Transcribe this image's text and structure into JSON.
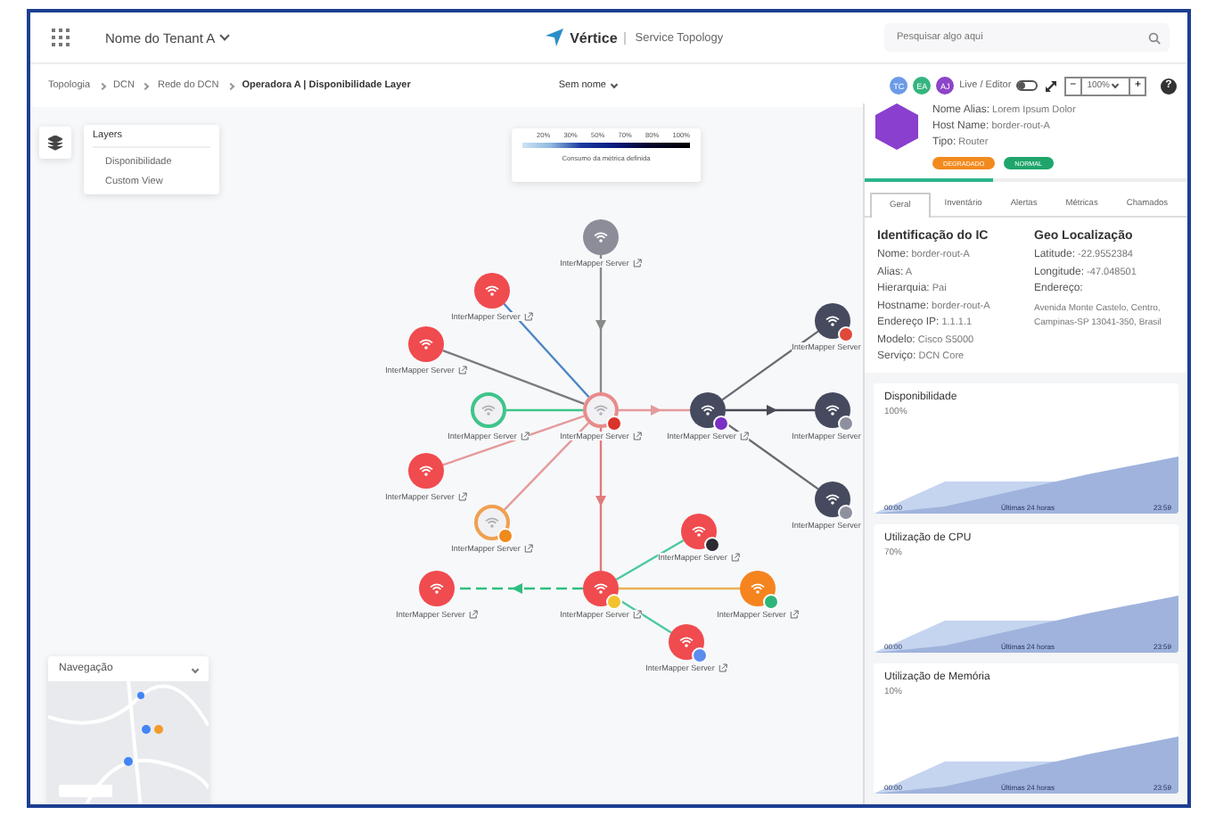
{
  "header": {
    "tenant": "Nome do Tenant A",
    "app_name": "Vértice",
    "subtitle": "Service Topology",
    "search": {
      "placeholder": "Pesquisar algo aqui"
    }
  },
  "breadcrumb": [
    "Topologia",
    "DCN",
    "Rede do DCN",
    "Operadora A | Disponibilidade Layer"
  ],
  "view_select": "Sem nome",
  "users": [
    {
      "initials": "TC",
      "color": "#6b9be8"
    },
    {
      "initials": "EA",
      "color": "#35b57e"
    },
    {
      "initials": "AJ",
      "color": "#8d45c8"
    }
  ],
  "mode_toggle": {
    "label": "Live / Editor",
    "on": false
  },
  "zoom": {
    "minus": "−",
    "value": "100%",
    "plus": "+"
  },
  "help": "?",
  "layers": {
    "title": "Layers",
    "items": [
      {
        "label": "Disponibilidade"
      },
      {
        "label": "Custom View"
      }
    ]
  },
  "legend": {
    "ticks": [
      "20%",
      "30%",
      "50%",
      "70%",
      "80%",
      "100%"
    ],
    "caption": "Consumo da métrica definida"
  },
  "nodes": [
    {
      "label": "InterMapper Server",
      "color": "#8d8d99",
      "kind": "filled"
    },
    {
      "label": "InterMapper Server",
      "color": "#f04b4f",
      "kind": "filled"
    },
    {
      "label": "InterMapper Server",
      "color": "#454a5e",
      "kind": "filled",
      "badge": {
        "color": "#e0483a"
      }
    },
    {
      "label": "InterMapper Server",
      "color": "#f04b4f",
      "kind": "filled"
    },
    {
      "label": "InterMapper Server",
      "color": "#3ec58a",
      "kind": "ring"
    },
    {
      "label": "InterMapper Server",
      "color": "#e88b8b",
      "kind": "ring",
      "badge": {
        "color": "#d9342b"
      }
    },
    {
      "label": "InterMapper Server",
      "color": "#454a5e",
      "kind": "filled",
      "badge": {
        "color": "#7b2fc4"
      }
    },
    {
      "label": "InterMapper Server",
      "color": "#454a5e",
      "kind": "filled",
      "badge": {
        "color": "#8e90a0"
      }
    },
    {
      "label": "InterMapper Server",
      "color": "#f04b4f",
      "kind": "filled"
    },
    {
      "label": "InterMapper Server",
      "color": "#454a5e",
      "kind": "filled",
      "badge": {
        "color": "#8e90a0"
      }
    },
    {
      "label": "InterMapper Server",
      "color": "#f0a050",
      "kind": "ring",
      "badge": {
        "color": "#f08a1c"
      }
    },
    {
      "label": "InterMapper Server",
      "color": "#f04b4f",
      "kind": "filled",
      "badge": {
        "color": "#2b2b33"
      }
    },
    {
      "label": "InterMapper Server",
      "color": "#f04b4f",
      "kind": "filled"
    },
    {
      "label": "InterMapper Server",
      "color": "#f04b4f",
      "kind": "filled",
      "badge": {
        "color": "#f2c230"
      }
    },
    {
      "label": "InterMapper Server",
      "color": "#f5841f",
      "kind": "filled",
      "badge": {
        "color": "#2fb57a"
      }
    },
    {
      "label": "InterMapper Server",
      "color": "#f04b4f",
      "kind": "filled",
      "badge": {
        "color": "#5b8def"
      }
    }
  ],
  "navigation": {
    "title": "Navegação"
  },
  "details": {
    "fields": [
      {
        "label": "Nome Alias:",
        "value": "Lorem Ipsum Dolor"
      },
      {
        "label": "Host Name:",
        "value": "border-rout-A"
      },
      {
        "label": "Tipo:",
        "value": "Router"
      }
    ],
    "tags": [
      {
        "text": "DEGRADADO",
        "color": "#f28a1e"
      },
      {
        "text": "NORMAL",
        "color": "#1fa56b"
      }
    ],
    "loading": {
      "level": 0.4
    },
    "tabs": [
      {
        "label": "Geral",
        "selected": true
      },
      {
        "label": "Inventário",
        "selected": false
      },
      {
        "label": "Alertas",
        "selected": false
      },
      {
        "label": "Métricas",
        "selected": false
      },
      {
        "label": "Chamados",
        "selected": false
      }
    ],
    "identification": {
      "title": "Identificação do IC",
      "fields": [
        {
          "label": "Nome:",
          "value": "border-rout-A"
        },
        {
          "label": "Alias:",
          "value": "A"
        },
        {
          "label": "Hierarquia:",
          "value": "Pai"
        },
        {
          "label": "Hostname:",
          "value": "border-rout-A"
        },
        {
          "label": "Endereço IP:",
          "value": "1.1.1.1"
        },
        {
          "label": "Modelo:",
          "value": "Cisco S5000"
        },
        {
          "label": "Serviço:",
          "value": "DCN Core"
        }
      ]
    },
    "geo": {
      "title": "Geo Localização",
      "fields": [
        {
          "label": "Latitude:",
          "value": "-22.9552384"
        },
        {
          "label": "Longitude:",
          "value": "-47.048501"
        }
      ],
      "address_label": "Endereço:",
      "address": "Avenida Monte Castelo, Centro, Campinas-SP 13041-350, Brasil"
    },
    "metrics": [
      {
        "title": "Disponibilidade",
        "value": "100%",
        "start": "00:00",
        "middle": "Últimas 24 horas",
        "end": "23:59"
      },
      {
        "title": "Utilização de CPU",
        "value": "70%",
        "start": "00:00",
        "middle": "Últimas 24 horas",
        "end": "23:59"
      },
      {
        "title": "Utilização de Memória",
        "value": "10%",
        "start": "00:00",
        "middle": "Últimas 24 horas",
        "end": "23:59"
      }
    ]
  }
}
